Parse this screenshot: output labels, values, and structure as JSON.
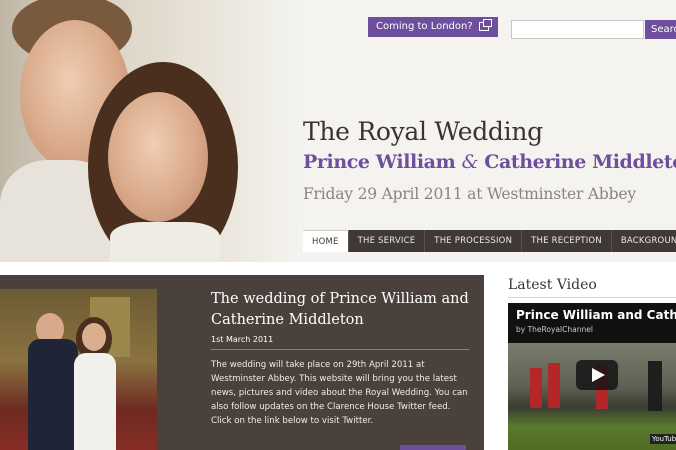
{
  "header": {
    "coming_label": "Coming to London?",
    "search_placeholder": "",
    "search_button": "Search",
    "title": "The Royal Wedding",
    "groom": "Prince William",
    "amp": "&",
    "bride": "Catherine Middleton",
    "date_line": "Friday 29 April 2011 at Westminster Abbey"
  },
  "nav": {
    "items": [
      "Home",
      "The Service",
      "The Procession",
      "The Reception",
      "Background"
    ]
  },
  "feature": {
    "title": "The wedding of Prince William and Catherine Middleton",
    "date": "1st March 2011",
    "text": "The wedding will take place on 29th April 2011 at Westminster Abbey. This website will bring you the latest news, pictures and video about the Royal Wedding. You can also follow updates on the Clarence House Twitter feed. Click on the link below to visit Twitter."
  },
  "latest_video": {
    "heading": "Latest Video",
    "video_title": "Prince William and Cather...",
    "channel": "by TheRoyalChannel",
    "logo": "YouTube"
  },
  "colors": {
    "accent_purple": "#6e4f9d",
    "dark_brown": "#4a413c",
    "nav_bar": "#3f3835"
  }
}
